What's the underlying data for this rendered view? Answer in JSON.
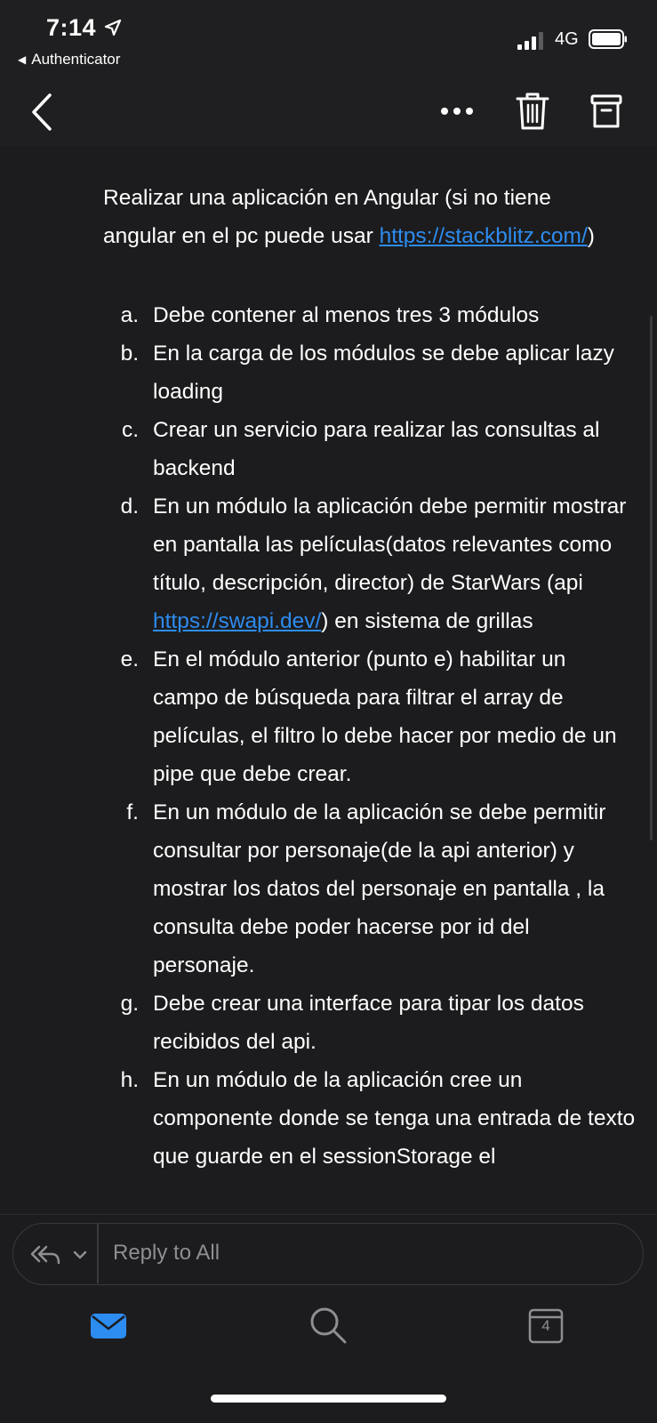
{
  "status_bar": {
    "time": "7:14",
    "back_app": "Authenticator",
    "network": "4G"
  },
  "nav": {
    "back_icon": "chevron-left-icon",
    "more_icon": "more-icon",
    "trash_icon": "trash-icon",
    "archive_icon": "archive-icon"
  },
  "email": {
    "intro_text": "Realizar una aplicación en Angular (si no tiene angular en el pc puede usar ",
    "intro_link": "https://stackblitz.com/",
    "intro_suffix": ")",
    "items": [
      {
        "marker": "a.",
        "text": "Debe contener al menos tres 3 módulos"
      },
      {
        "marker": "b.",
        "text": "En la carga de los módulos se debe aplicar lazy loading"
      },
      {
        "marker": "c.",
        "text": "Crear un servicio para realizar las consultas al backend"
      },
      {
        "marker": "d.",
        "text_before": "En un módulo la aplicación debe permitir mostrar en pantalla las películas(datos relevantes como título, descripción, director) de StarWars (api ",
        "link": "https://swapi.dev/",
        "text_after": ") en sistema de grillas"
      },
      {
        "marker": "e.",
        "text": "En el módulo anterior (punto e) habilitar un campo de búsqueda para filtrar el array de películas, el filtro lo debe hacer por medio de un pipe que debe crear."
      },
      {
        "marker": "f.",
        "text": "En un módulo de la aplicación se debe permitir consultar por personaje(de la api anterior) y mostrar los datos del personaje en pantalla , la consulta debe poder hacerse por id del personaje."
      },
      {
        "marker": "g.",
        "text": "Debe crear una interface para tipar los datos recibidos del api."
      },
      {
        "marker": "h.",
        "text": "En un módulo de la aplicación cree un componente donde se tenga una entrada de texto que guarde en el sessionStorage el"
      }
    ]
  },
  "reply": {
    "placeholder": "Reply to All"
  },
  "tab_bar": {
    "calendar_day": "4"
  },
  "colors": {
    "accent": "#2d8cf0",
    "background": "#1c1c1e"
  }
}
